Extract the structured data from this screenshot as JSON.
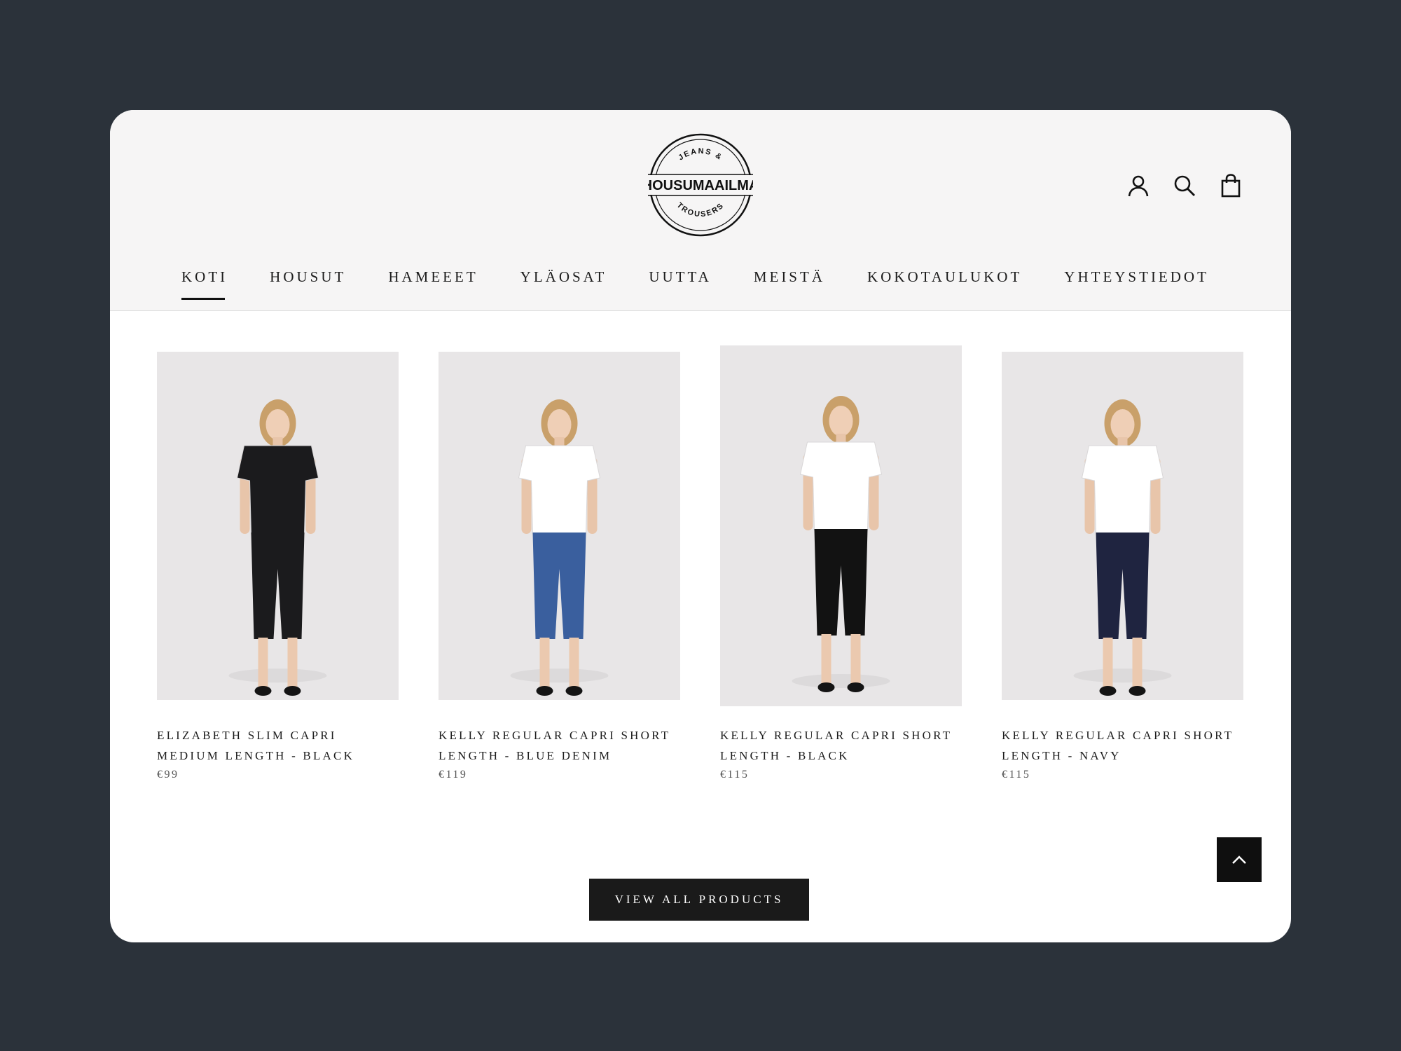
{
  "brand": {
    "name": "HOUSUMAAILMA",
    "top_text": "JEANS &",
    "bottom_text": "TROUSERS"
  },
  "header": {
    "icons": [
      "account-icon",
      "search-icon",
      "cart-icon"
    ]
  },
  "nav": [
    {
      "label": "KOTI",
      "active": true
    },
    {
      "label": "HOUSUT",
      "active": false
    },
    {
      "label": "HAMEEET",
      "active": false
    },
    {
      "label": "YLÄOSAT",
      "active": false
    },
    {
      "label": "UUTTA",
      "active": false
    },
    {
      "label": "MEISTÄ",
      "active": false
    },
    {
      "label": "KOKOTAULUKOT",
      "active": false
    },
    {
      "label": "YHTEYSTIEDOT",
      "active": false
    }
  ],
  "products": [
    {
      "name_line1": "ELIZABETH SLIM CAPRI",
      "name_line2": "MEDIUM LENGTH - BLACK",
      "price": "€99",
      "pants_color": "#1b1b1d",
      "top_color": "#1b1b1d"
    },
    {
      "name_line1": "KELLY REGULAR CAPRI SHORT",
      "name_line2": "LENGTH - BLUE DENIM",
      "price": "€119",
      "pants_color": "#3a5f9e",
      "top_color": "#ffffff"
    },
    {
      "name_line1": "KELLY REGULAR CAPRI SHORT",
      "name_line2": "LENGTH - BLACK",
      "price": "€115",
      "pants_color": "#121212",
      "top_color": "#ffffff"
    },
    {
      "name_line1": "KELLY REGULAR CAPRI SHORT",
      "name_line2": "LENGTH - NAVY",
      "price": "€115",
      "pants_color": "#1f2440",
      "top_color": "#ffffff"
    }
  ],
  "buttons": {
    "view_all": "VIEW ALL PRODUCTS"
  },
  "colors": {
    "page_bg": "#2b323a",
    "header_bg": "#f6f5f5",
    "button_bg": "#1a1a1a"
  }
}
